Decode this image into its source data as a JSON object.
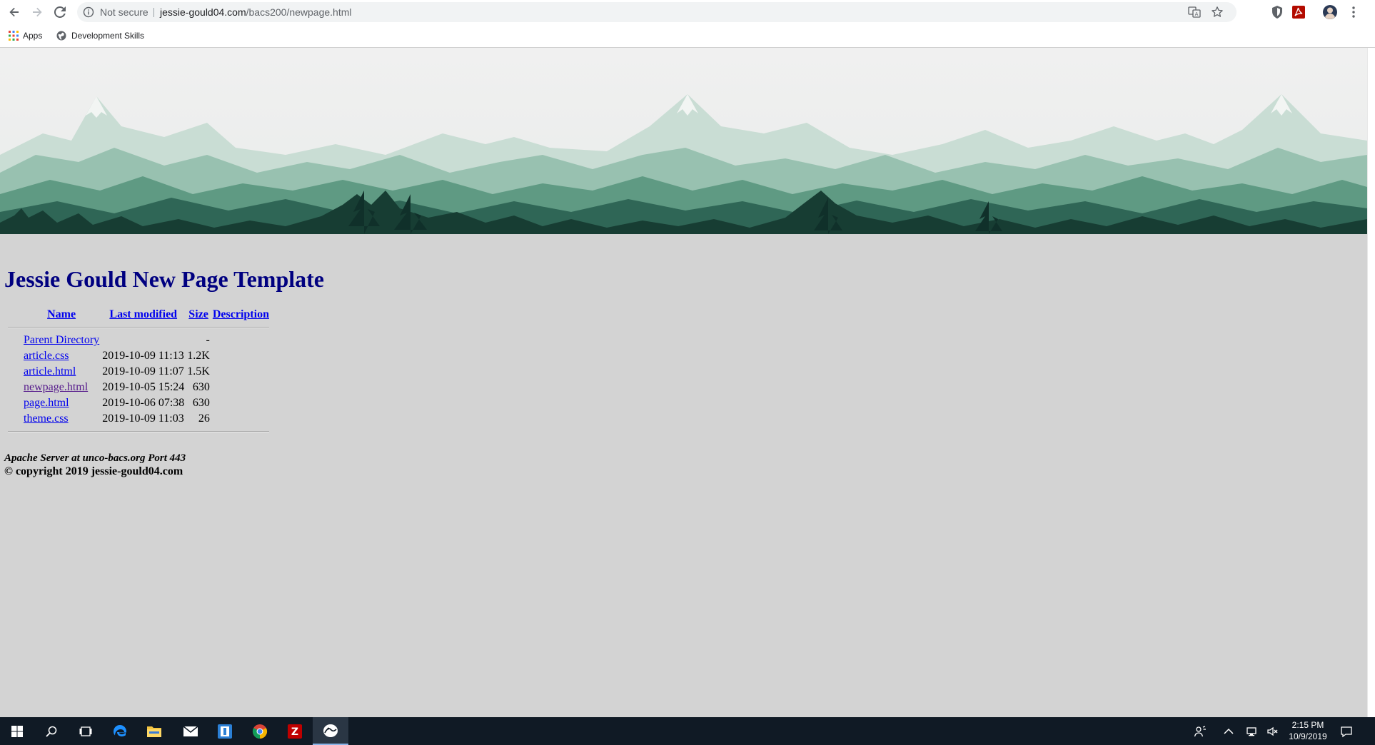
{
  "browser": {
    "security_label": "Not secure",
    "url_host": "jessie-gould04.com",
    "url_path": "/bacs200/newpage.html",
    "bookmarks": [
      {
        "label": "Apps",
        "icon": "apps-grid-icon"
      },
      {
        "label": "Development Skills",
        "icon": "globe-icon"
      }
    ]
  },
  "page": {
    "title": "Jessie Gould New Page Template",
    "columns": {
      "name": "Name",
      "last_modified": "Last modified",
      "size": "Size",
      "description": "Description"
    },
    "parent": {
      "name": "Parent Directory",
      "size": "-"
    },
    "files": [
      {
        "name": "article.css",
        "modified": "2019-10-09 11:13",
        "size": "1.2K"
      },
      {
        "name": "article.html",
        "modified": "2019-10-09 11:07",
        "size": "1.5K"
      },
      {
        "name": "newpage.html",
        "modified": "2019-10-05 15:24",
        "size": "630"
      },
      {
        "name": "page.html",
        "modified": "2019-10-06 07:38",
        "size": "630"
      },
      {
        "name": "theme.css",
        "modified": "2019-10-09 11:03",
        "size": "26"
      }
    ],
    "server_signature": "Apache Server at unco-bacs.org Port 443",
    "copyright": "© copyright 2019 jessie-gould04.com"
  },
  "taskbar": {
    "time": "2:15 PM",
    "date": "10/9/2019",
    "pinned": [
      "windows-start-icon",
      "search-icon",
      "task-view-icon",
      "edge-icon",
      "file-explorer-icon",
      "mail-icon",
      "sourcetree-icon",
      "chrome-icon",
      "filezilla-icon",
      "cyberduck-icon"
    ]
  },
  "colors": {
    "page_background": "#d3d3d3",
    "title": "#000080",
    "link": "#0000ee",
    "visited_link": "#551a8b",
    "taskbar": "#101a25"
  }
}
